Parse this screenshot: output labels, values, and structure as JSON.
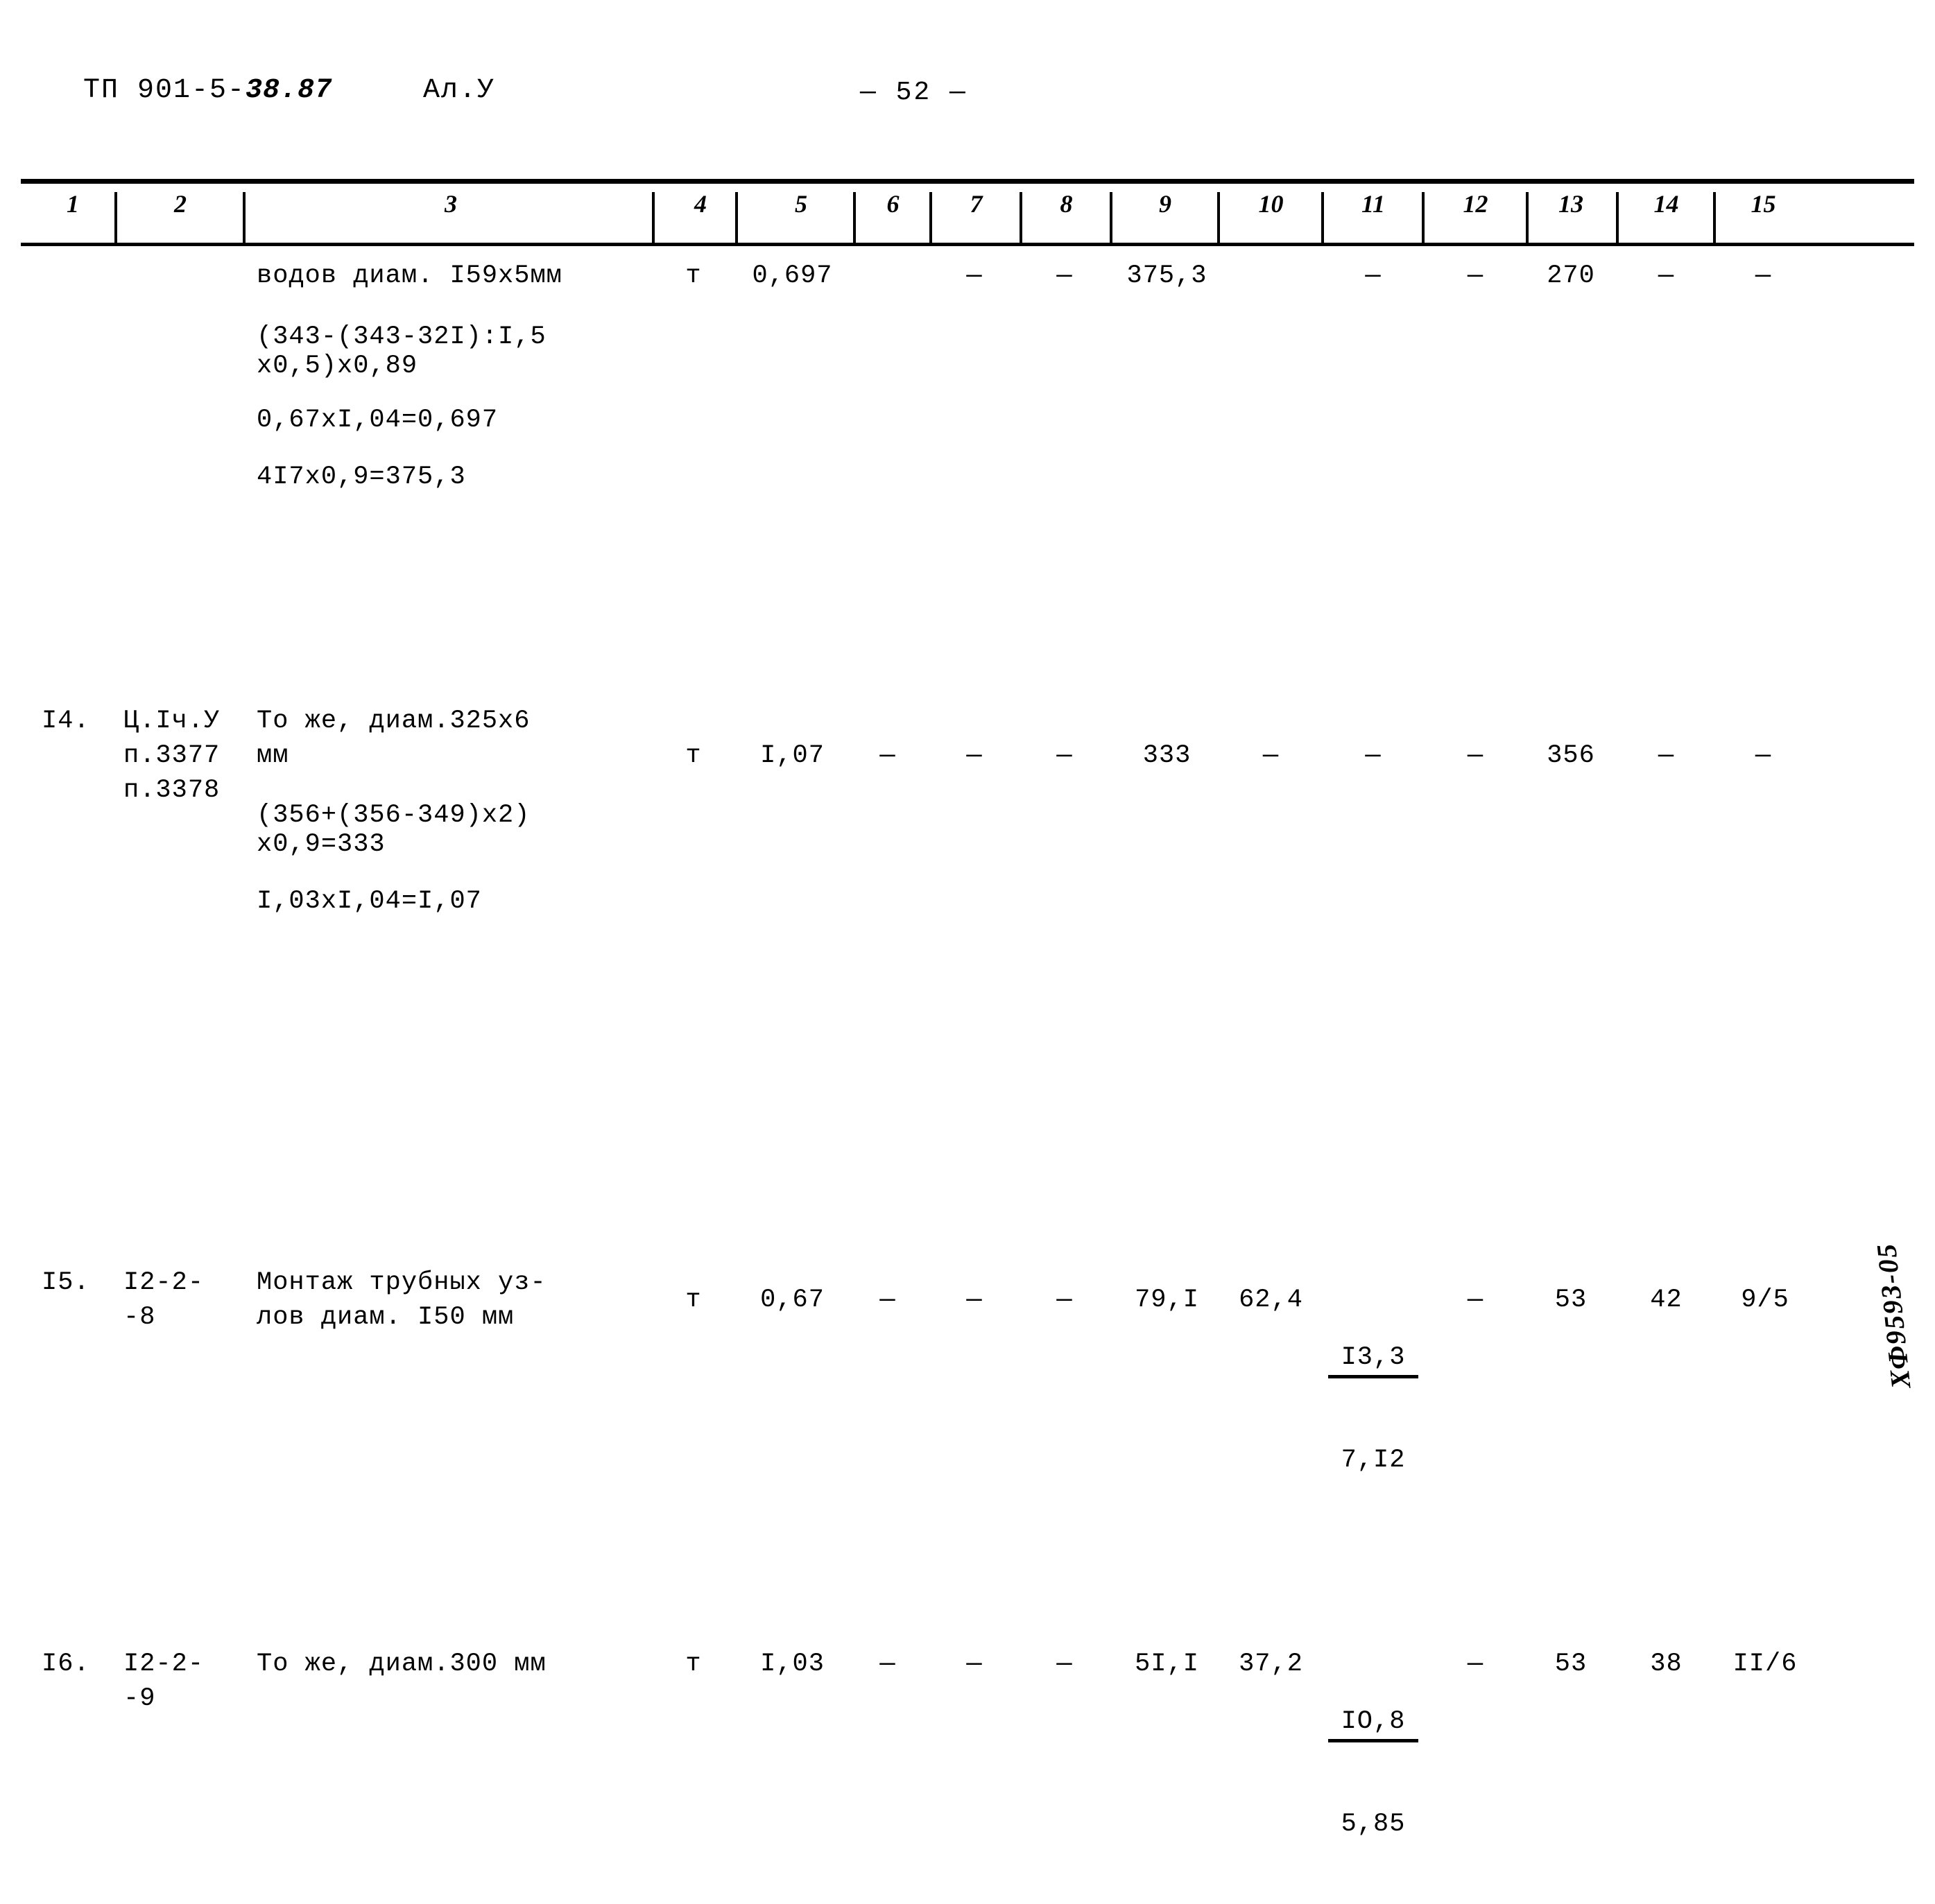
{
  "header": {
    "doc_code_prefix": "ТП 901-5-",
    "doc_code_suffix": "38.87",
    "sheet_label": "Ал.У",
    "page_number": "— 52 —"
  },
  "table": {
    "column_numbers": [
      "1",
      "2",
      "3",
      "4",
      "5",
      "6",
      "7",
      "8",
      "9",
      "10",
      "11",
      "12",
      "13",
      "14",
      "15"
    ],
    "rows": [
      {
        "id": "row-continuation",
        "col1": "",
        "col2": "",
        "col3": "водов диам. I59х5мм",
        "col4": "т",
        "col5": "0,697",
        "col6": "",
        "col7": "—",
        "col8": "—",
        "col9": "375,3",
        "col10": "",
        "col11": "—",
        "col12": "—",
        "col13": "270",
        "col14": "—",
        "col15": "—",
        "calculations": [
          "(343-(343-32I):I,5",
          "х0,5)х0,89",
          "0,67хI,04=0,697",
          "4I7х0,9=375,3"
        ]
      },
      {
        "id": "row-14",
        "col1": "I4.",
        "col2": "Ц.Iч.У\nп.3377\nп.3378",
        "col3": "То же, диам.325х6\nмм",
        "col4": "т",
        "col5": "I,07",
        "col6": "—",
        "col7": "—",
        "col8": "—",
        "col9": "333",
        "col10": "—",
        "col11": "—",
        "col12": "—",
        "col13": "356",
        "col14": "—",
        "col15": "—",
        "calculations": [
          "(356+(356-349)х2)",
          "х0,9=333",
          "I,03хI,04=I,07"
        ]
      },
      {
        "id": "row-15",
        "col1": "I5.",
        "col2": "I2-2-\n-8",
        "col3": "Монтаж трубных уз-\nлов диам. I50 мм",
        "col4": "т",
        "col5": "0,67",
        "col6": "—",
        "col7": "—",
        "col8": "—",
        "col9": "79,I",
        "col10": "62,4",
        "col11_numerator": "I3,3",
        "col11_denominator": "7,I2",
        "col12": "—",
        "col13": "53",
        "col14": "42",
        "col15": "9/5",
        "calculations": []
      },
      {
        "id": "row-16",
        "col1": "I6.",
        "col2": "I2-2-\n-9",
        "col3": "То же, диам.300 мм",
        "col4": "т",
        "col5": "I,03",
        "col6": "—",
        "col7": "—",
        "col8": "—",
        "col9": "5I,I",
        "col10": "37,2",
        "col11_numerator": "IO,8",
        "col11_denominator": "5,85",
        "col12": "—",
        "col13": "53",
        "col14": "38",
        "col15": "II/6",
        "calculations": []
      }
    ]
  },
  "corner_stamp": {
    "text": "ХФ9593-05"
  }
}
